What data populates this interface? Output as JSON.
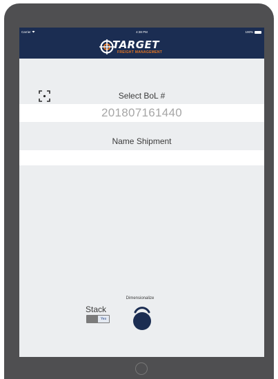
{
  "status_bar": {
    "carrier": "Carrier",
    "time": "4:38 PM",
    "battery": "100%"
  },
  "header": {
    "logo_text": "TARGET",
    "logo_subtext": "FREIGHT MANAGEMENT"
  },
  "bol": {
    "label": "Select BoL #",
    "value": "201807161440"
  },
  "shipment": {
    "label": "Name Shipment",
    "value": ""
  },
  "stack": {
    "label": "Stack",
    "toggle_text": "Yes",
    "toggle_on": true
  },
  "dimensionalize": {
    "label": "Dimensionalize"
  },
  "icons": {
    "scan": "scan-icon",
    "wifi": "wifi-icon",
    "battery": "battery-icon",
    "dimensionalize": "dimensionalize-icon",
    "home": "home-button"
  },
  "colors": {
    "navy": "#1b2d52",
    "accent_orange": "#e87722",
    "background": "#eceef0",
    "field": "#ffffff"
  }
}
